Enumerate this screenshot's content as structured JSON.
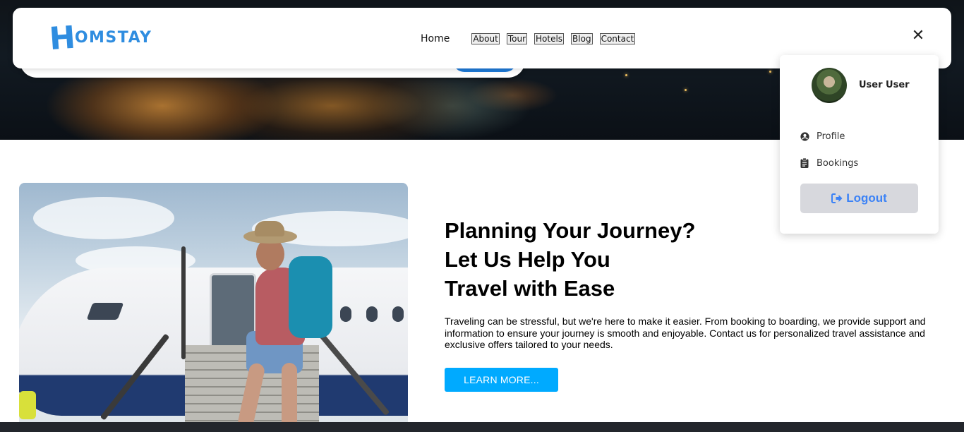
{
  "brand": {
    "logo_initial": "H",
    "logo_rest": "OMSTAY"
  },
  "nav": {
    "home": "Home",
    "links": [
      "About",
      "Tour",
      "Hotels",
      "Blog",
      "Contact"
    ],
    "close_icon": "close-icon"
  },
  "user_menu": {
    "name": "User User",
    "items": [
      {
        "label": "Profile",
        "icon": "user-circle-icon"
      },
      {
        "label": "Bookings",
        "icon": "clipboard-icon"
      }
    ],
    "logout_label": "Logout",
    "logout_icon": "sign-out-icon"
  },
  "promo": {
    "headline": [
      "Planning Your Journey?",
      "Let Us Help You",
      "Travel with Ease"
    ],
    "description": "Traveling can be stressful, but we're here to make it easier. From booking to boarding, we provide support and information to ensure your journey is smooth and enjoyable. Contact us for personalized travel assistance and exclusive offers tailored to your needs.",
    "cta_label": "LEARN MORE..."
  },
  "colors": {
    "brand_blue": "#2f8de0",
    "cta_blue": "#00aaff",
    "logout_text": "#3b82f6",
    "logout_bg": "#d7d8dd"
  }
}
